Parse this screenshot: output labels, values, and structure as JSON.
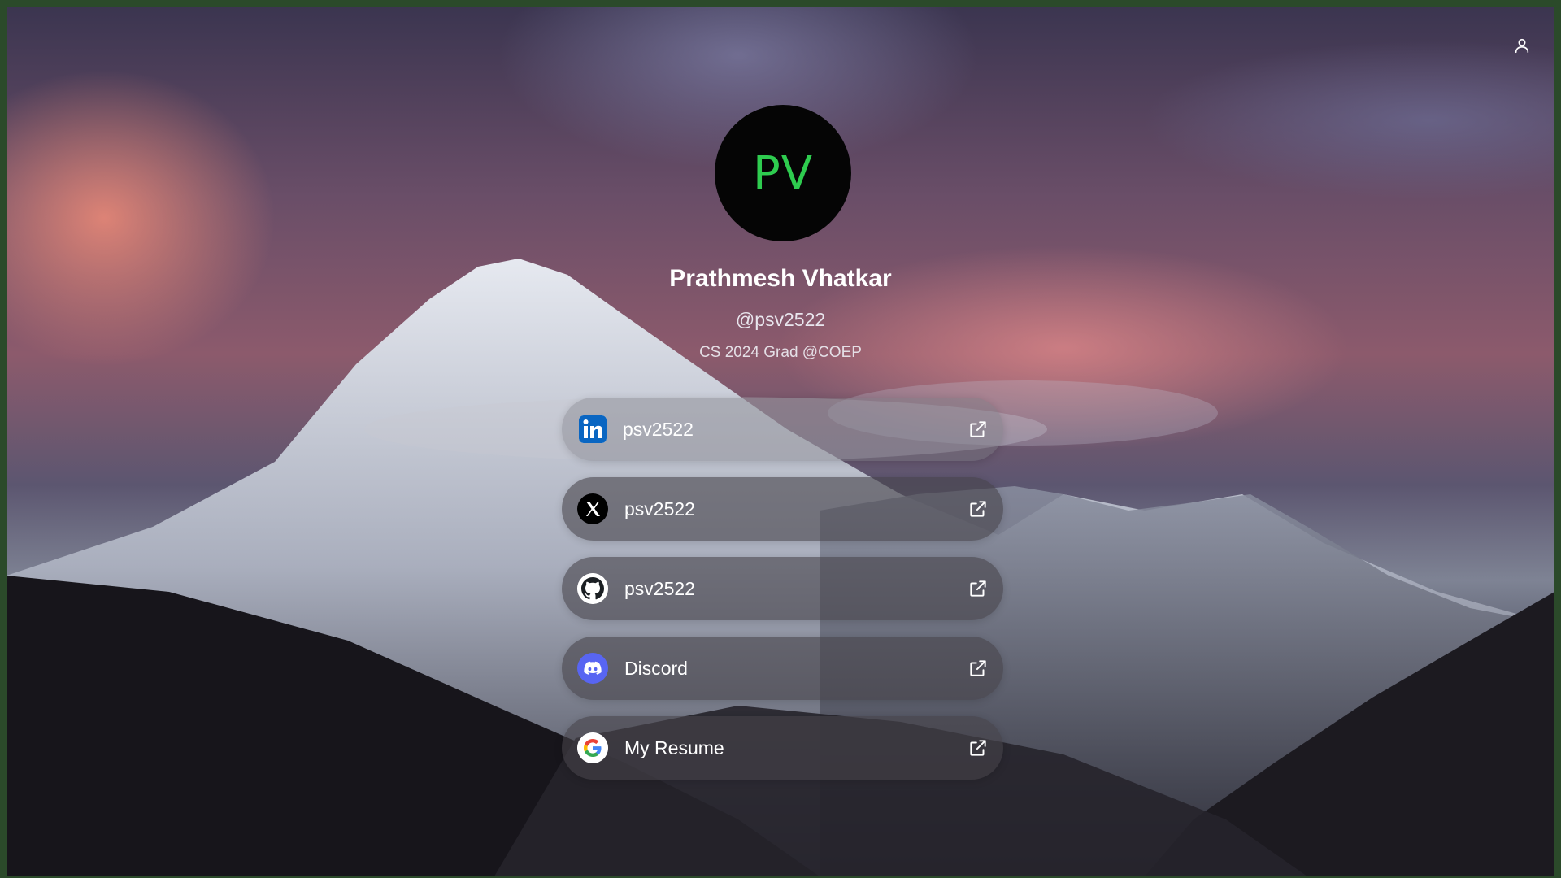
{
  "profile": {
    "initials": "PV",
    "name": "Prathmesh Vhatkar",
    "handle": "@psv2522",
    "bio": "CS 2024 Grad @COEP"
  },
  "header": {
    "profile_icon": "user-icon"
  },
  "links": [
    {
      "label": "psv2522",
      "icon": "linkedin-icon"
    },
    {
      "label": "psv2522",
      "icon": "x-twitter-icon"
    },
    {
      "label": "psv2522",
      "icon": "github-icon"
    },
    {
      "label": "Discord",
      "icon": "discord-icon"
    },
    {
      "label": "My Resume",
      "icon": "google-icon"
    }
  ],
  "colors": {
    "avatar_bg": "#050505",
    "avatar_text": "#2ecc4f",
    "linkedin": "#0a66c2",
    "discord": "#5865f2"
  }
}
